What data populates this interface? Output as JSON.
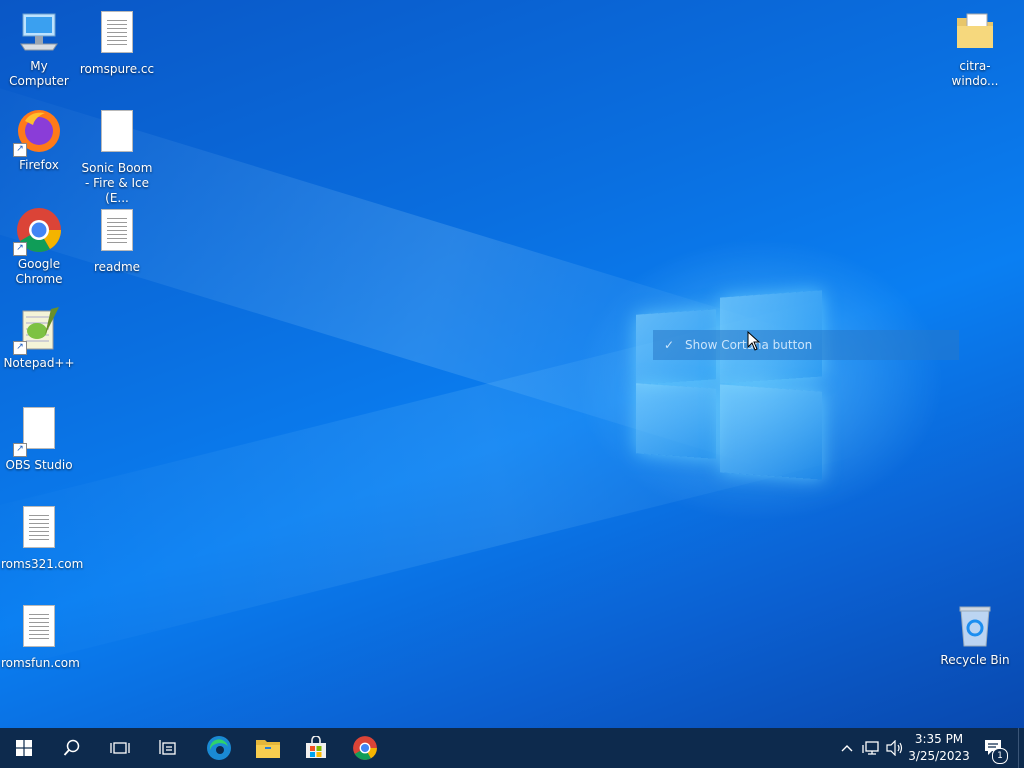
{
  "desktop": {
    "icons": [
      {
        "label": "My Computer",
        "icon": "computer-icon"
      },
      {
        "label": "romspure.cc",
        "icon": "document-icon"
      },
      {
        "label": "Firefox",
        "icon": "firefox-icon"
      },
      {
        "label": "Sonic Boom - Fire & Ice (E...",
        "icon": "blank-file-icon"
      },
      {
        "label": "Google Chrome",
        "icon": "chrome-icon"
      },
      {
        "label": "readme",
        "icon": "document-icon"
      },
      {
        "label": "Notepad++",
        "icon": "notepadpp-icon"
      },
      {
        "label": "OBS Studio",
        "icon": "blank-file-icon"
      },
      {
        "label": "roms321.com",
        "icon": "document-icon"
      },
      {
        "label": "romsfun.com",
        "icon": "document-icon"
      },
      {
        "label": "citra-windo...",
        "icon": "folder-icon"
      },
      {
        "label": "Recycle Bin",
        "icon": "recycle-bin-icon"
      }
    ]
  },
  "context_menu": {
    "item_label": "Show Cortana button",
    "checked_symbol": "✓"
  },
  "taskbar": {
    "buttons": [
      "start-icon",
      "search-icon",
      "task-view-icon",
      "widgets-icon",
      "edge-icon",
      "file-explorer-icon",
      "store-icon",
      "chrome-icon"
    ],
    "tray": {
      "chevron": "^",
      "time": "3:35 PM",
      "date": "3/25/2023",
      "notification_count": "1"
    }
  }
}
